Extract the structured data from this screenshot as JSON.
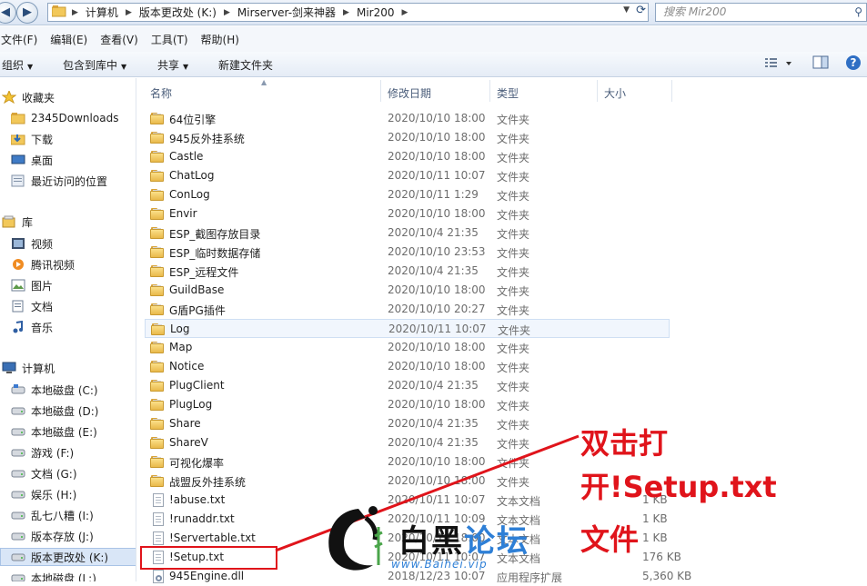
{
  "address": {
    "crumbs": [
      "计算机",
      "版本更改处 (K:)",
      "Mirserver-剑来神器",
      "Mir200"
    ],
    "search_placeholder": "搜索 Mir200"
  },
  "menu": [
    "文件(F)",
    "编辑(E)",
    "查看(V)",
    "工具(T)",
    "帮助(H)"
  ],
  "toolbar": {
    "organize": "组织",
    "include": "包含到库中",
    "share": "共享",
    "new_folder": "新建文件夹"
  },
  "sidebar": {
    "favorites": "收藏夹",
    "fav_items": [
      "2345Downloads",
      "下载",
      "桌面",
      "最近访问的位置"
    ],
    "libraries": "库",
    "lib_items": [
      "视频",
      "腾讯视频",
      "图片",
      "文档",
      "音乐"
    ],
    "computer": "计算机",
    "drives": [
      "本地磁盘 (C:)",
      "本地磁盘 (D:)",
      "本地磁盘 (E:)",
      "游戏 (F:)",
      "文档 (G:)",
      "娱乐 (H:)",
      "乱七八糟 (I:)",
      "版本存放 (J:)",
      "版本更改处 (K:)",
      "本地磁盘 (L:)"
    ],
    "selected_drive_index": 8
  },
  "columns": {
    "name": "名称",
    "date": "修改日期",
    "type": "类型",
    "size": "大小"
  },
  "files": [
    {
      "name": "64位引擎",
      "date": "2020/10/10 18:00",
      "type": "文件夹",
      "size": "",
      "kind": "folder"
    },
    {
      "name": "945反外挂系统",
      "date": "2020/10/10 18:00",
      "type": "文件夹",
      "size": "",
      "kind": "folder"
    },
    {
      "name": "Castle",
      "date": "2020/10/10 18:00",
      "type": "文件夹",
      "size": "",
      "kind": "folder"
    },
    {
      "name": "ChatLog",
      "date": "2020/10/11 10:07",
      "type": "文件夹",
      "size": "",
      "kind": "folder"
    },
    {
      "name": "ConLog",
      "date": "2020/10/11 1:29",
      "type": "文件夹",
      "size": "",
      "kind": "folder"
    },
    {
      "name": "Envir",
      "date": "2020/10/10 18:00",
      "type": "文件夹",
      "size": "",
      "kind": "folder"
    },
    {
      "name": "ESP_截图存放目录",
      "date": "2020/10/4 21:35",
      "type": "文件夹",
      "size": "",
      "kind": "folder"
    },
    {
      "name": "ESP_临时数据存储",
      "date": "2020/10/10 23:53",
      "type": "文件夹",
      "size": "",
      "kind": "folder"
    },
    {
      "name": "ESP_远程文件",
      "date": "2020/10/4 21:35",
      "type": "文件夹",
      "size": "",
      "kind": "folder"
    },
    {
      "name": "GuildBase",
      "date": "2020/10/10 18:00",
      "type": "文件夹",
      "size": "",
      "kind": "folder"
    },
    {
      "name": "G盾PG插件",
      "date": "2020/10/10 20:27",
      "type": "文件夹",
      "size": "",
      "kind": "folder"
    },
    {
      "name": "Log",
      "date": "2020/10/11 10:07",
      "type": "文件夹",
      "size": "",
      "kind": "folder"
    },
    {
      "name": "Map",
      "date": "2020/10/10 18:00",
      "type": "文件夹",
      "size": "",
      "kind": "folder"
    },
    {
      "name": "Notice",
      "date": "2020/10/10 18:00",
      "type": "文件夹",
      "size": "",
      "kind": "folder"
    },
    {
      "name": "PlugClient",
      "date": "2020/10/4 21:35",
      "type": "文件夹",
      "size": "",
      "kind": "folder"
    },
    {
      "name": "PlugLog",
      "date": "2020/10/10 18:00",
      "type": "文件夹",
      "size": "",
      "kind": "folder"
    },
    {
      "name": "Share",
      "date": "2020/10/4 21:35",
      "type": "文件夹",
      "size": "",
      "kind": "folder"
    },
    {
      "name": "ShareV",
      "date": "2020/10/4 21:35",
      "type": "文件夹",
      "size": "",
      "kind": "folder"
    },
    {
      "name": "可视化爆率",
      "date": "2020/10/10 18:00",
      "type": "文件夹",
      "size": "",
      "kind": "folder"
    },
    {
      "name": "战盟反外挂系统",
      "date": "2020/10/10 18:00",
      "type": "文件夹",
      "size": "",
      "kind": "folder"
    },
    {
      "name": "!abuse.txt",
      "date": "2020/10/11 10:07",
      "type": "文本文档",
      "size": "1 KB",
      "kind": "txt"
    },
    {
      "name": "!runaddr.txt",
      "date": "2020/10/11 10:09",
      "type": "文本文档",
      "size": "1 KB",
      "kind": "txt"
    },
    {
      "name": "!Servertable.txt",
      "date": "2020/10/10 18:00",
      "type": "文本文档",
      "size": "1 KB",
      "kind": "txt"
    },
    {
      "name": "!Setup.txt",
      "date": "2020/10/11 10:07",
      "type": "文本文档",
      "size": "176 KB",
      "kind": "txt"
    },
    {
      "name": "945Engine.dll",
      "date": "2018/12/23 10:07",
      "type": "应用程序扩展",
      "size": "5,360 KB",
      "kind": "dll"
    }
  ],
  "hovered_row_index": 11,
  "annotation": {
    "line1": "双击打开!Setup.txt",
    "line2": "文件",
    "color": "#e0141b"
  },
  "watermark": {
    "brand_a": "白黑",
    "brand_b": "论坛",
    "url": "www.Baihei.vip",
    "accent": "#2e7fd6"
  }
}
